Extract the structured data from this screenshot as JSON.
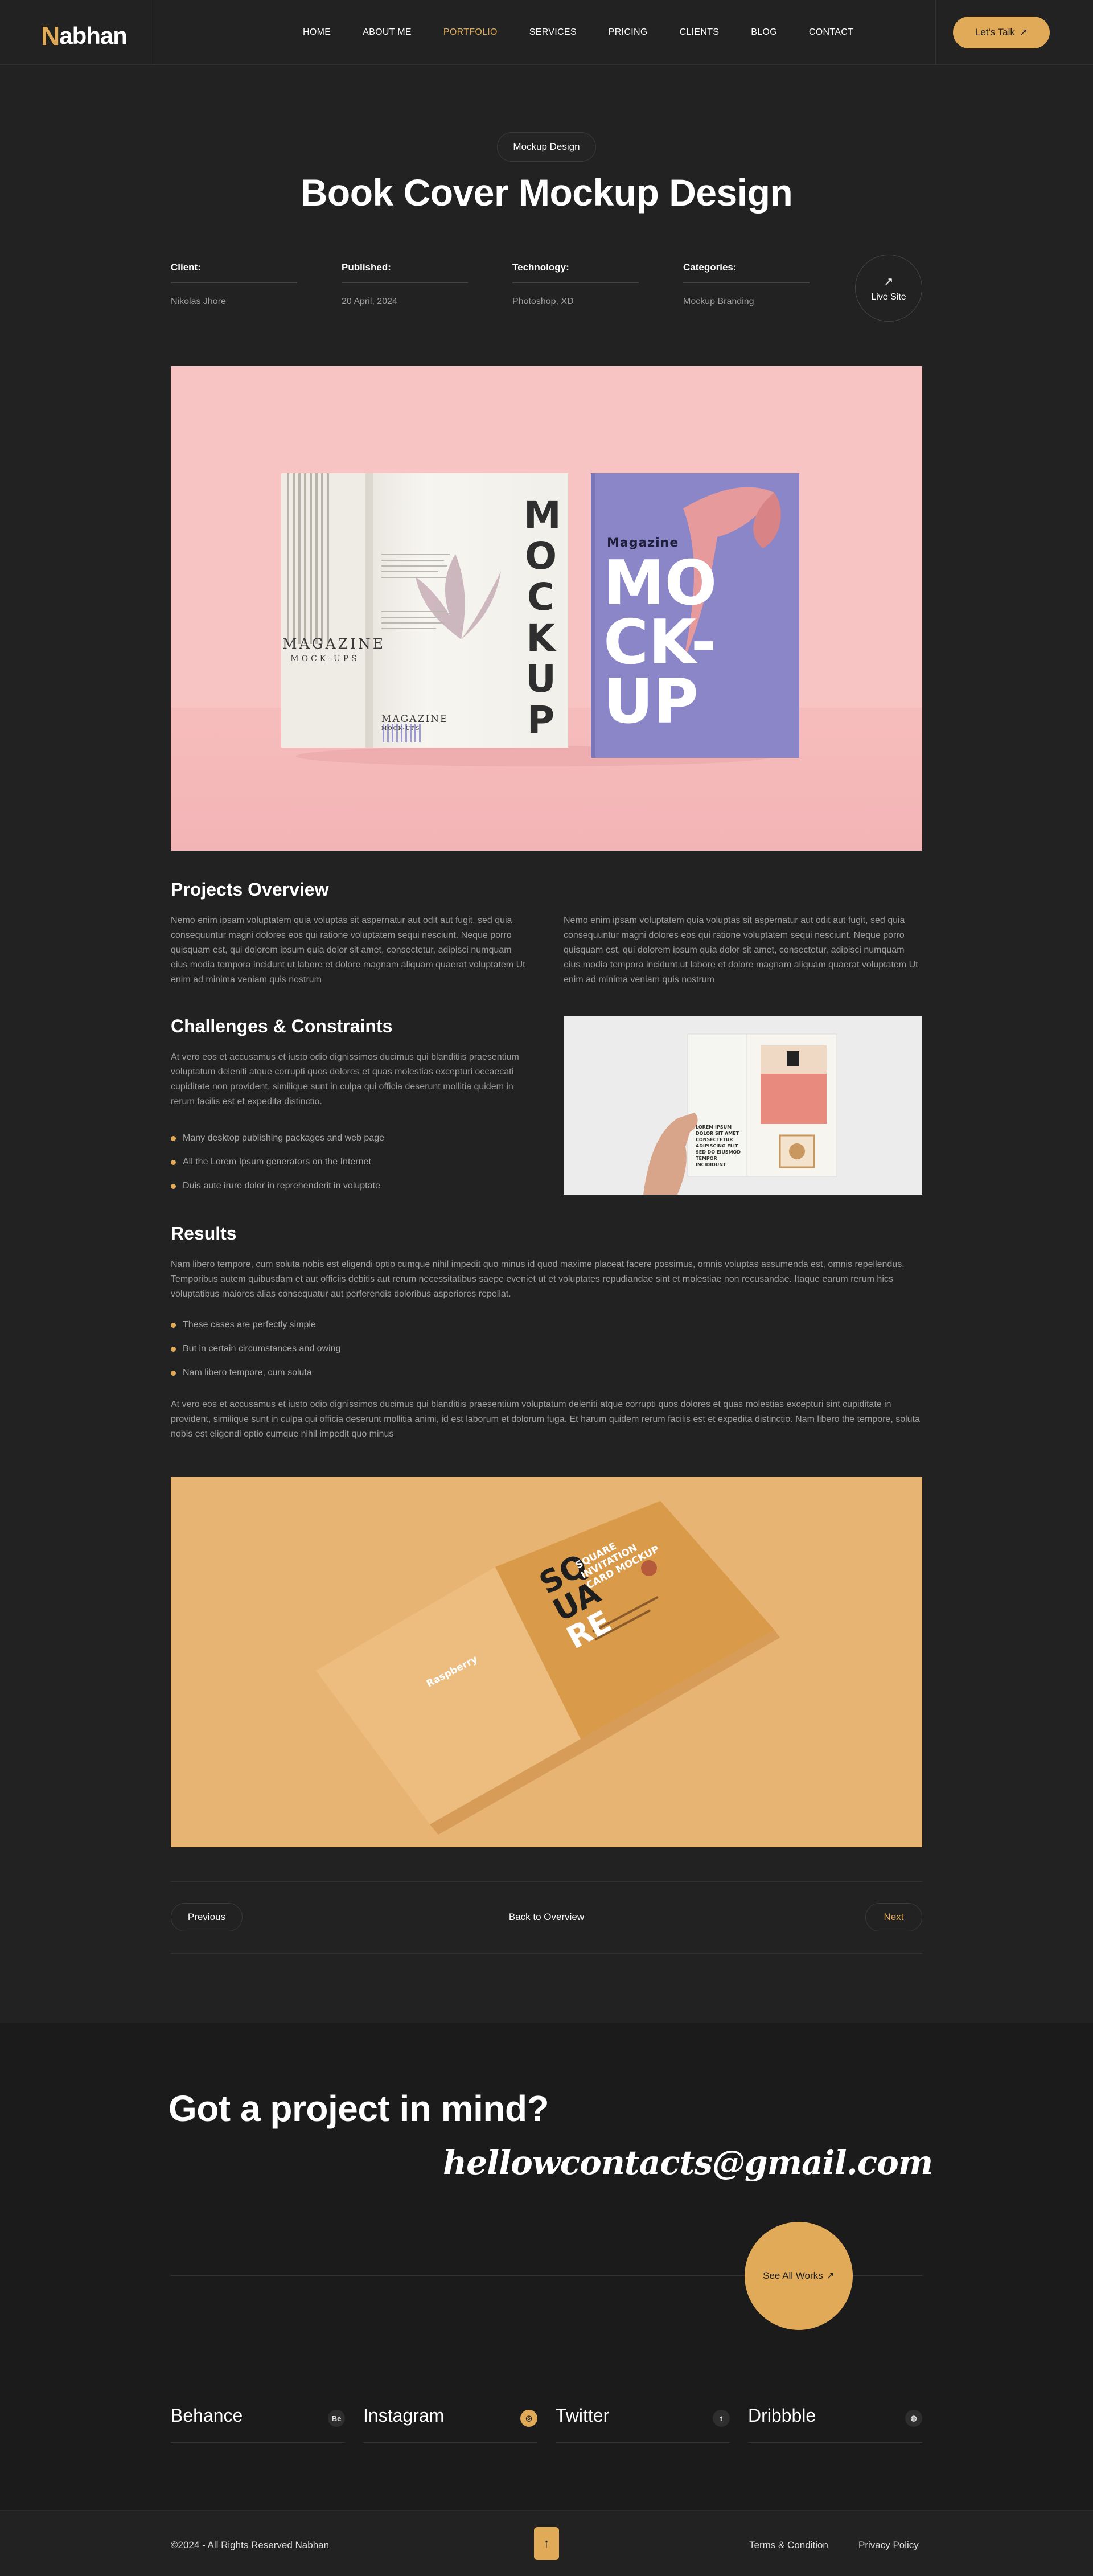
{
  "brand": {
    "logo_initial": "N",
    "logo_rest": "abhan"
  },
  "nav": [
    {
      "label": "HOME",
      "active": false
    },
    {
      "label": "ABOUT ME",
      "active": false
    },
    {
      "label": "PORTFOLIO",
      "active": true
    },
    {
      "label": "SERVICES",
      "active": false
    },
    {
      "label": "PRICING",
      "active": false
    },
    {
      "label": "CLIENTS",
      "active": false
    },
    {
      "label": "BLOG",
      "active": false
    },
    {
      "label": "CONTACT",
      "active": false
    }
  ],
  "header": {
    "cta_label": "Let's Talk"
  },
  "hero": {
    "tag": "Mockup Design",
    "title": "Book Cover Mockup Design",
    "meta": [
      {
        "label": "Client:",
        "value": "Nikolas Jhore"
      },
      {
        "label": "Published:",
        "value": "20 April, 2024"
      },
      {
        "label": "Technology:",
        "value": "Photoshop, XD"
      },
      {
        "label": "Categories:",
        "value": "Mockup Branding"
      }
    ],
    "live_label": "Live Site"
  },
  "hero_image": {
    "left_book_spine_text": "MAGAZINE",
    "left_book_spine_sub": "MOCK-UPS",
    "page_vertical_word": "MOCKUP",
    "page_footer": "MAGAZINE",
    "page_footer_sub": "MOCK-UPS",
    "cover_small": "Magazine",
    "cover_big_1": "MO",
    "cover_big_2": "CK-",
    "cover_big_3": "UP"
  },
  "overview": {
    "title": "Projects Overview",
    "left": "Nemo enim ipsam voluptatem quia voluptas sit aspernatur aut odit aut fugit, sed quia consequuntur magni dolores eos qui ratione voluptatem sequi nesciunt. Neque porro quisquam est, qui dolorem ipsum quia dolor sit amet, consectetur, adipisci numquam eius modia tempora incidunt ut labore et dolore magnam aliquam quaerat voluptatem Ut enim ad minima veniam quis nostrum",
    "right": "Nemo enim ipsam voluptatem quia voluptas sit aspernatur aut odit aut fugit, sed quia consequuntur magni dolores eos qui ratione voluptatem sequi nesciunt. Neque porro quisquam est, qui dolorem ipsum quia dolor sit amet, consectetur, adipisci numquam eius modia tempora incidunt ut labore et dolore magnam aliquam quaerat voluptatem Ut enim ad minima veniam quis nostrum"
  },
  "challenges": {
    "title": "Challenges & Constraints",
    "text": "At vero eos et accusamus et iusto odio dignissimos ducimus qui blanditiis praesentium voluptatum deleniti atque corrupti quos dolores et quas molestias excepturi occaecati cupiditate non provident, similique sunt in culpa qui officia deserunt mollitia quidem in rerum facilis est et expedita distinctio.",
    "bullets": [
      "Many desktop publishing packages and web page",
      "All the Lorem Ipsum generators on the Internet",
      "Duis aute irure dolor in reprehenderit in voluptate"
    ],
    "image_text": "LOREM IPSUM DOLOR SIT AMET CONSECTETUR ADIPISCING ELIT SED DO EIUSMOD TEMPOR INCIDIDUNT"
  },
  "results": {
    "title": "Results",
    "text1": "Nam libero tempore, cum soluta nobis est eligendi optio cumque nihil impedit quo minus id quod maxime placeat facere possimus, omnis voluptas assumenda est, omnis repellendus. Temporibus autem quibusdam et aut officiis debitis aut rerum necessitatibus saepe eveniet ut et voluptates repudiandae sint et molestiae non recusandae. Itaque earum rerum hics voluptatibus maiores alias consequatur aut perferendis doloribus asperiores repellat.",
    "bullets": [
      "These cases are perfectly simple",
      "But in certain circumstances and owing",
      "Nam libero tempore, cum soluta"
    ],
    "text2": "At vero eos et accusamus et iusto odio dignissimos ducimus qui blanditiis praesentium voluptatum deleniti atque corrupti quos dolores et quas molestias excepturi sint cupiditate in provident, similique sunt in culpa qui officia deserunt mollitia animi, id est laborum et dolorum fuga. Et harum quidem rerum facilis est et expedita distinctio. Nam libero the tempore, soluta nobis est eligendi optio cumque nihil impedit quo minus"
  },
  "yellow_image": {
    "big_letters_1": "SQ",
    "big_letters_2": "UA",
    "big_letters_3": "RE",
    "headline": "SQUARE INVITATION CARD MOCKUP",
    "brand_name": "Raspberry"
  },
  "pager": {
    "previous": "Previous",
    "overview": "Back to Overview",
    "next": "Next"
  },
  "cta": {
    "title": "Got a project in mind?",
    "email": "hellowcontacts@gmail.com",
    "see_all": "See All Works"
  },
  "social": [
    {
      "name": "Behance",
      "icon": "Be",
      "active": false
    },
    {
      "name": "Instagram",
      "icon": "◎",
      "active": true
    },
    {
      "name": "Twitter",
      "icon": "t",
      "active": false
    },
    {
      "name": "Dribbble",
      "icon": "◍",
      "active": false
    }
  ],
  "footer": {
    "copyright": "©2024 - All Rights Reserved Nabhan",
    "up_icon": "↑",
    "links": [
      "Terms & Condition",
      "Privacy Policy"
    ]
  },
  "colors": {
    "accent": "#e0aa58",
    "bg": "#222222",
    "pink": "#f8c3c3",
    "cover": "#8a86c8"
  }
}
